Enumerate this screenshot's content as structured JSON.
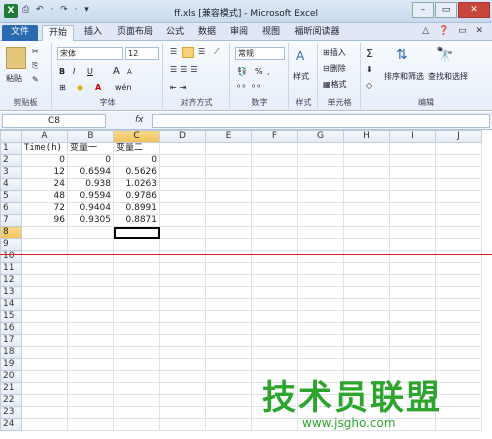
{
  "window": {
    "title": "ff.xls [兼容模式] - Microsoft Excel",
    "qat": "⎙ ↶ · ↷ · ▾",
    "controls": {
      "minimize": "–",
      "maximize": "▭",
      "close": "✕"
    }
  },
  "tabs": {
    "file": "文件",
    "items": [
      "开始",
      "插入",
      "页面布局",
      "公式",
      "数据",
      "审阅",
      "视图",
      "福昕阅读器"
    ],
    "help": "△ ❓ ▭ ✕"
  },
  "ribbon": {
    "clipboard": {
      "paste": "粘贴",
      "label": "剪贴板"
    },
    "font": {
      "name": "宋体",
      "size": "12",
      "label": "字体",
      "bold": "B",
      "italic": "I",
      "underline": "U",
      "grow": "A",
      "shrink": "A",
      "wen": "wén"
    },
    "alignment": {
      "label": "对齐方式"
    },
    "number": {
      "format": "常规",
      "percent": "%",
      "comma": ",",
      "label": "数字"
    },
    "styles": {
      "label": "样式",
      "button": "样式"
    },
    "cells": {
      "insert": "插入",
      "delete": "删除",
      "format": "格式",
      "label": "单元格"
    },
    "editing": {
      "sort": "排序和筛选",
      "find": "查找和选择",
      "label": "编辑",
      "sigma": "Σ"
    }
  },
  "formula_bar": {
    "name_box": "C8",
    "fx": "fx",
    "value": ""
  },
  "sheet": {
    "columns": [
      "A",
      "B",
      "C",
      "D",
      "E",
      "F",
      "G",
      "H",
      "I",
      "J"
    ],
    "selected_column": "C",
    "selected_row": 8,
    "rows": [
      [
        "Time(h)",
        "变量一",
        "变量二"
      ],
      [
        "0",
        "0",
        "0"
      ],
      [
        "12",
        "0.6594",
        "0.5626"
      ],
      [
        "24",
        "0.938",
        "1.0263"
      ],
      [
        "48",
        "0.9594",
        "0.9786"
      ],
      [
        "72",
        "0.9404",
        "0.8991"
      ],
      [
        "96",
        "0.9305",
        "0.8871"
      ]
    ],
    "row_count": 24
  },
  "watermark": {
    "text": "技术员联盟",
    "url": "www.jsgho.com",
    "color": "#2da52d"
  }
}
